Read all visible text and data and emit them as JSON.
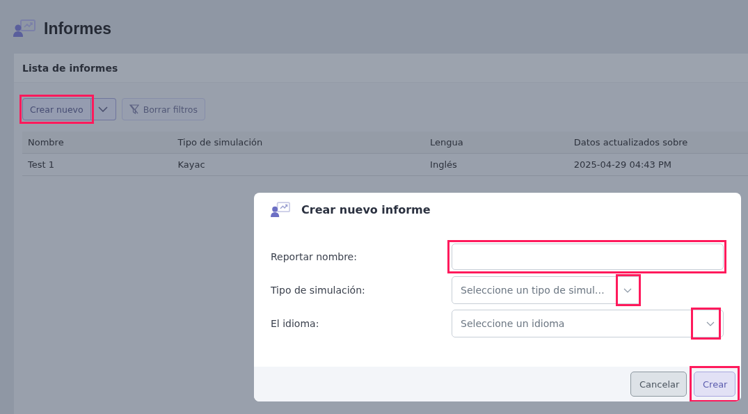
{
  "page": {
    "title": "Informes"
  },
  "card": {
    "title": "Lista de informes"
  },
  "toolbar": {
    "create_button": {
      "label": "Crear nuevo",
      "highlighted": true
    },
    "clear_filters_button": {
      "label": "Borrar filtros"
    }
  },
  "table": {
    "columns": [
      "Nombre",
      "Tipo de simulación",
      "Lengua",
      "Datos actualizados sobre"
    ],
    "rows": [
      [
        "Test 1",
        "Kayac",
        "Inglés",
        "2025-04-29 04:43 PM"
      ]
    ]
  },
  "dialog": {
    "title": "Crear nuevo informe",
    "fields": [
      {
        "kind": "text",
        "label": "Reportar nombre:",
        "highlighted": true
      },
      {
        "kind": "select",
        "label": "Tipo de simulación:",
        "placeholder": "Seleccione un tipo de simul…",
        "highlighted": true
      },
      {
        "kind": "select",
        "label": "El idioma:",
        "placeholder": "Seleccione un idioma",
        "highlighted": true
      }
    ],
    "buttons": [
      {
        "kind": "secondary",
        "label": "Cancelar",
        "highlighted": false
      },
      {
        "kind": "primary",
        "label": "Crear",
        "highlighted": true
      }
    ]
  }
}
